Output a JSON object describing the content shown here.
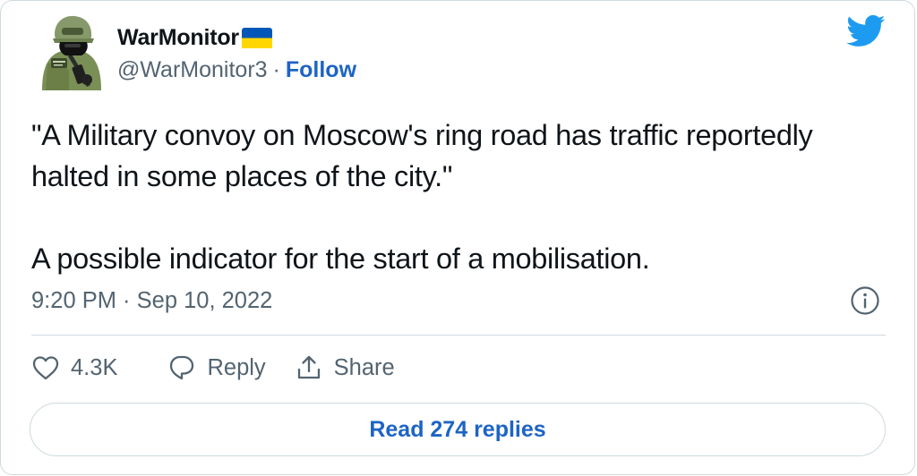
{
  "user": {
    "name": "WarMonitor",
    "handle": "@WarMonitor3",
    "separator": "·",
    "follow_label": "Follow"
  },
  "tweet": {
    "paragraph_1": "\"A Military convoy on Moscow's ring road has traffic reportedly halted in some places of the city.\"",
    "paragraph_2": "A possible indicator for the start of a mobilisation.",
    "timestamp": "9:20 PM · Sep 10, 2022"
  },
  "actions": {
    "like_count": "4.3K",
    "reply_label": "Reply",
    "share_label": "Share"
  },
  "read_replies_label": "Read 274 replies",
  "icons": {
    "brand": "twitter-bird-icon",
    "flag": "ukraine-flag-icon",
    "info": "info-icon",
    "like": "heart-icon",
    "reply": "reply-bubble-icon",
    "share": "share-upload-icon"
  },
  "colors": {
    "text_primary": "#0f1419",
    "text_secondary": "#536471",
    "link": "#1d64c4",
    "twitter_blue": "#1d9bf0",
    "border": "#cfd9de",
    "flag_blue": "#0057b7",
    "flag_yellow": "#ffd700"
  }
}
